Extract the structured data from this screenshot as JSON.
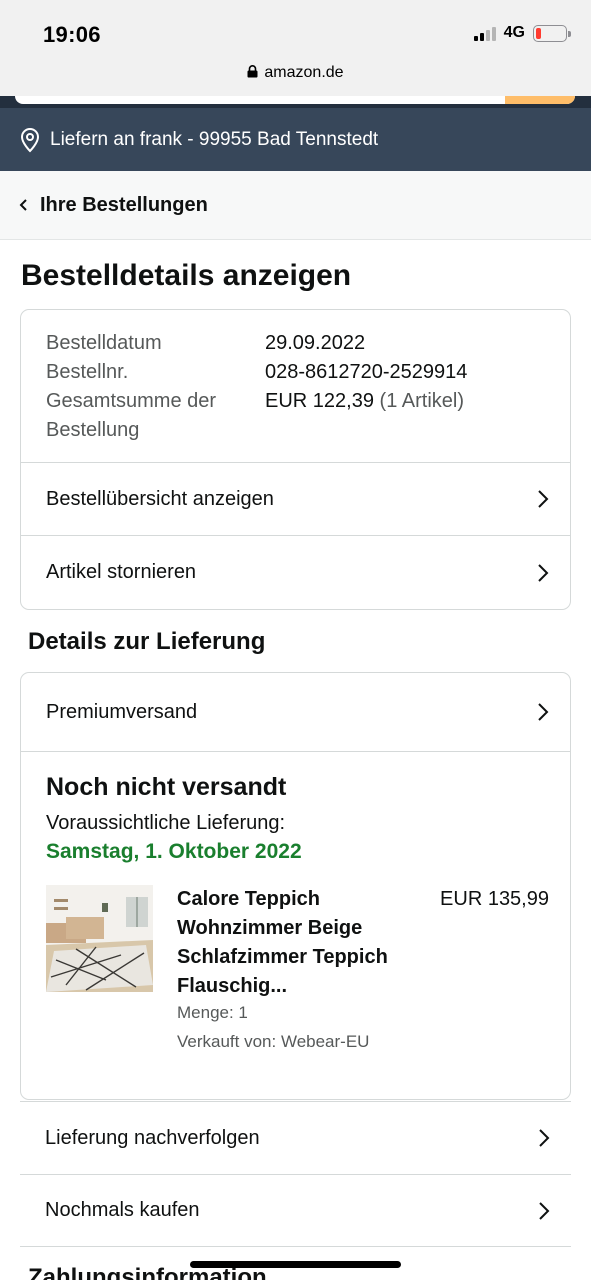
{
  "status_bar": {
    "time": "19:06",
    "network": "4G"
  },
  "browser": {
    "url": "amazon.de"
  },
  "location": {
    "text": "Liefern an frank - 99955 Bad Tennstedt"
  },
  "nav": {
    "back_label": "Ihre Bestellungen"
  },
  "page": {
    "title": "Bestelldetails anzeigen"
  },
  "order": {
    "date_label": "Bestelldatum",
    "date_value": "29.09.2022",
    "number_label": "Bestellnr.",
    "number_value": "028-8612720-2529914",
    "total_label_1": "Gesamtsumme der",
    "total_label_2": "Bestellung",
    "total_value": "EUR 122,39",
    "total_items": "(1 Artikel)",
    "summary_link": "Bestellübersicht anzeigen",
    "cancel_link": "Artikel stornieren"
  },
  "delivery": {
    "section_title": "Details zur Lieferung",
    "shipping_method": "Premiumversand",
    "status": "Noch nicht versandt",
    "eta_label": "Voraussichtliche Lieferung:",
    "eta_date": "Samstag, 1. Oktober 2022",
    "product": {
      "title": "Calore Teppich Wohnzimmer Beige Schlafzimmer Teppich Flauschig...",
      "price": "EUR 135,99",
      "quantity": "Menge: 1",
      "seller": "Verkauft von: Webear-EU"
    }
  },
  "actions": {
    "track": "Lieferung nachverfolgen",
    "buy_again": "Nochmals kaufen"
  },
  "payment": {
    "section_title": "Zahlungsinformation"
  },
  "colors": {
    "header_dark": "#37475a",
    "eta_green": "#1a7f2e",
    "border": "#d5d9d9"
  }
}
